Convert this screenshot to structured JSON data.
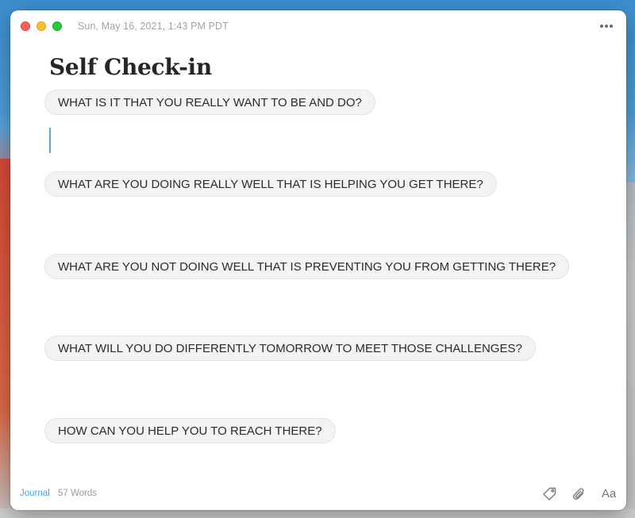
{
  "entry": {
    "date": "Sun, May 16, 2021, 1:43 PM PDT",
    "title": "Self Check-in",
    "questions": [
      "WHAT IS IT THAT YOU REALLY WANT TO BE AND DO?",
      "WHAT ARE YOU DOING REALLY WELL THAT IS HELPING YOU GET THERE?",
      "WHAT ARE YOU NOT DOING WELL THAT IS PREVENTING YOU FROM GETTING THERE?",
      "WHAT WILL YOU DO DIFFERENTLY TOMORROW TO MEET THOSE CHALLENGES?",
      "HOW CAN YOU HELP YOU TO REACH THERE?"
    ]
  },
  "footer": {
    "journal_label": "Journal",
    "word_count": "57 Words",
    "font_button_label": "Aa"
  },
  "icons": {
    "more": "more-icon",
    "tag": "tag-icon",
    "attachment": "paperclip-icon",
    "font": "font-icon"
  },
  "colors": {
    "accent": "#4aa3e0",
    "close": "#fe5f57",
    "minimize": "#febc2e",
    "zoom": "#28c840",
    "question_bg": "#f3f3f3"
  }
}
